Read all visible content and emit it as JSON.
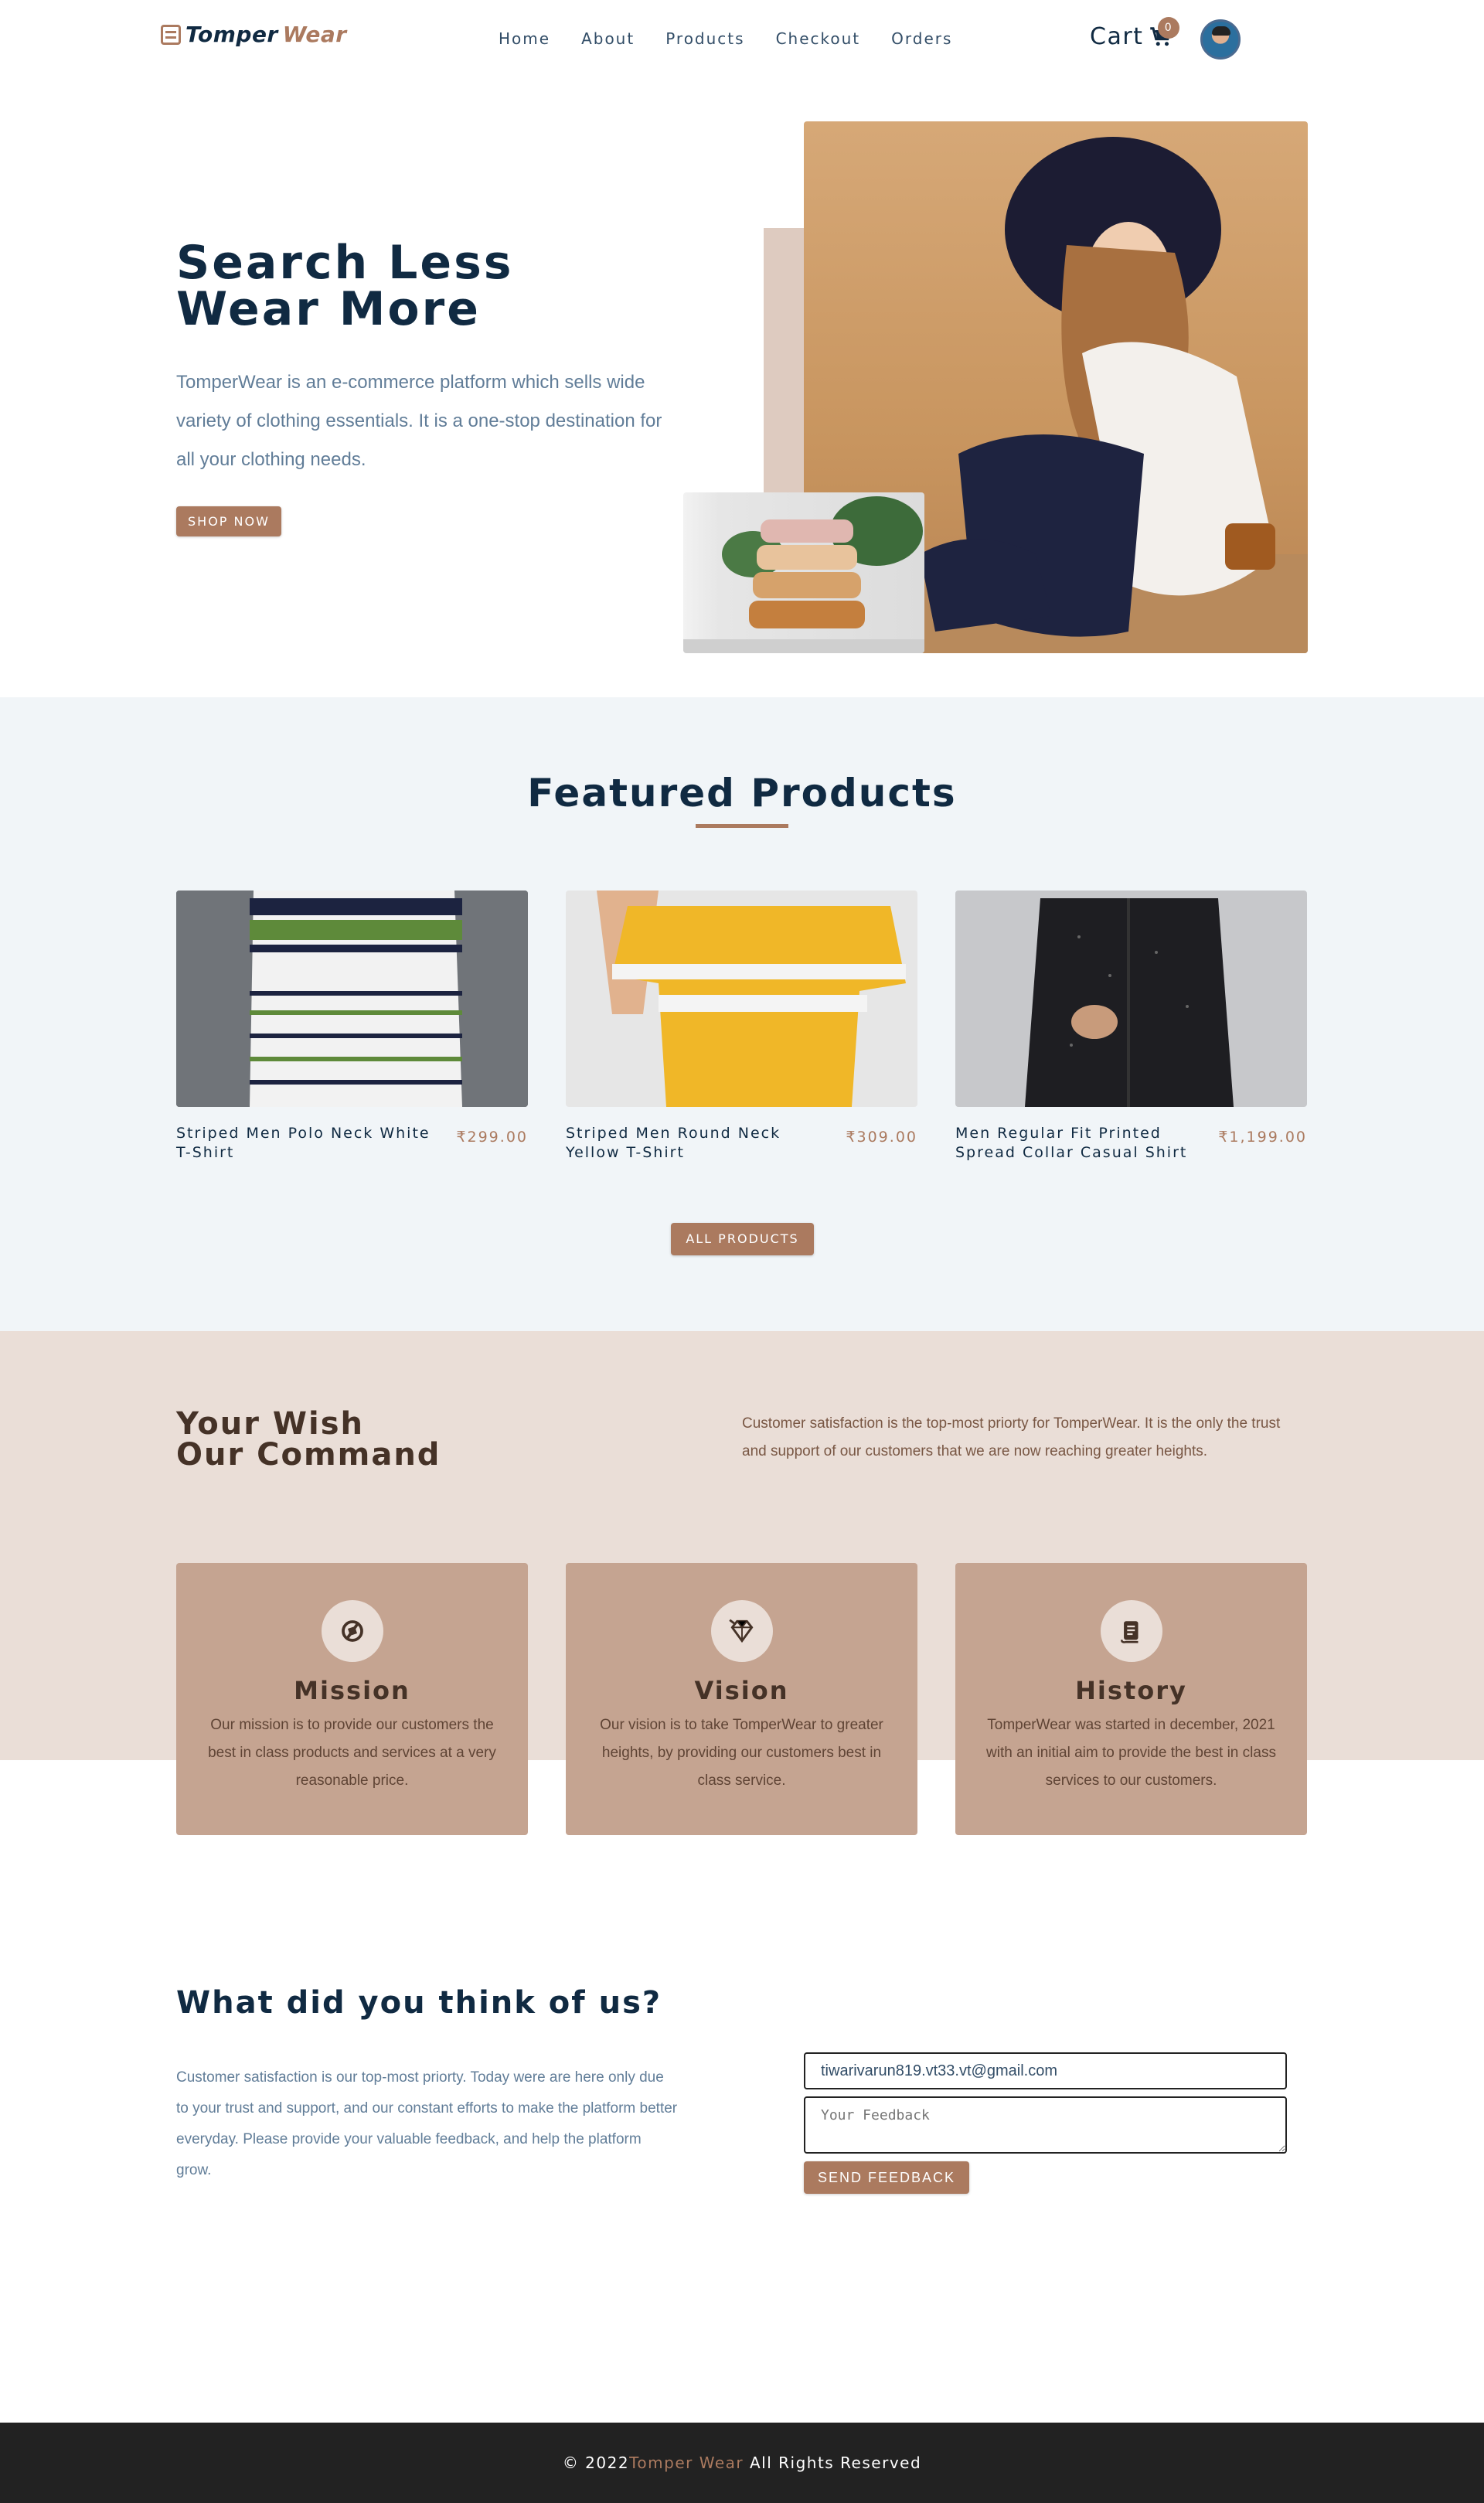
{
  "nav": {
    "logo_part1": "Tomper",
    "logo_part2": "Wear",
    "links": [
      "Home",
      "About",
      "Products",
      "Checkout",
      "Orders"
    ],
    "cart_label": "Cart",
    "cart_count": "0"
  },
  "hero": {
    "title_line1": "Search Less",
    "title_line2": "Wear More",
    "description": "TomperWear is an e-commerce platform which sells wide variety of clothing essentials. It is a one-stop destination for all your clothing needs.",
    "button": "SHOP NOW"
  },
  "featured": {
    "title": "Featured Products",
    "products": [
      {
        "name": "Striped Men Polo Neck White T-Shirt",
        "price": "₹299.00"
      },
      {
        "name": "Striped Men Round Neck Yellow T-Shirt",
        "price": "₹309.00"
      },
      {
        "name": "Men Regular Fit Printed Spread Collar Casual Shirt",
        "price": "₹1,199.00"
      }
    ],
    "button": "ALL PRODUCTS"
  },
  "about": {
    "title_line1": "Your Wish",
    "title_line2": "Our Command",
    "description": "Customer satisfaction is the top-most priorty for TomperWear. It is the only the trust and support of our customers that we are now reaching greater heights.",
    "cards": [
      {
        "icon": "compass-icon",
        "title": "Mission",
        "text": "Our mission is to provide our customers the best in class products and services at a very reasonable price."
      },
      {
        "icon": "diamond-icon",
        "title": "Vision",
        "text": "Our vision is to take TomperWear to greater heights, by providing our customers best in class service."
      },
      {
        "icon": "scroll-icon",
        "title": "History",
        "text": "TomperWear was started in december, 2021 with an initial aim to provide the best in class services to our customers."
      }
    ]
  },
  "contact": {
    "title": "What did you think of us?",
    "description": "Customer satisfaction is our top-most priorty. Today were are here only due to your trust and support, and our constant efforts to make the platform better everyday. Please provide your valuable feedback, and help the platform grow.",
    "email_value": "tiwarivarun819.vt33.vt@gmail.com",
    "feedback_placeholder": "Your Feedback",
    "button": "SEND FEEDBACK"
  },
  "footer": {
    "prefix": "© 2022",
    "brand": "Tomper Wear",
    "suffix": " All Rights Reserved"
  },
  "colors": {
    "primary": "#ab7a5f",
    "dark": "#102a42",
    "grey_text": "#617d98",
    "light_bg": "#f1f5f8",
    "about_bg": "#eaded7",
    "card_bg": "#c5a491",
    "footer_bg": "#222222"
  }
}
